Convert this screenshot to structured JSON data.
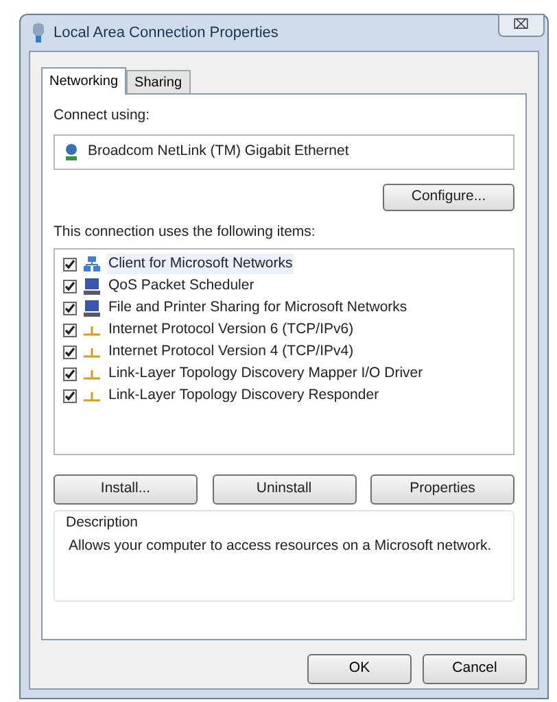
{
  "window": {
    "title": "Local Area Connection Properties",
    "close_label": "⌧"
  },
  "tabs": [
    {
      "label": "Networking",
      "selected": true
    },
    {
      "label": "Sharing",
      "selected": false
    }
  ],
  "connect_using": {
    "label": "Connect using:",
    "adapter": "Broadcom NetLink (TM) Gigabit Ethernet",
    "configure_button": "Configure..."
  },
  "items_label": "This connection uses the following items:",
  "items": [
    {
      "kind": "client",
      "label": "Client for Microsoft Networks",
      "checked": true,
      "selected": true
    },
    {
      "kind": "service",
      "label": "QoS Packet Scheduler",
      "checked": true,
      "selected": false
    },
    {
      "kind": "service",
      "label": "File and Printer Sharing for Microsoft Networks",
      "checked": true,
      "selected": false
    },
    {
      "kind": "protocol",
      "label": "Internet Protocol Version 6 (TCP/IPv6)",
      "checked": true,
      "selected": false
    },
    {
      "kind": "protocol",
      "label": "Internet Protocol Version 4 (TCP/IPv4)",
      "checked": true,
      "selected": false
    },
    {
      "kind": "protocol",
      "label": "Link-Layer Topology Discovery Mapper I/O Driver",
      "checked": true,
      "selected": false
    },
    {
      "kind": "protocol",
      "label": "Link-Layer Topology Discovery Responder",
      "checked": true,
      "selected": false
    }
  ],
  "item_buttons": [
    "Install...",
    "Uninstall",
    "Properties"
  ],
  "description": {
    "label": "Description",
    "text": "Allows your computer to access resources on a Microsoft network."
  },
  "dialog_buttons": [
    "OK",
    "Cancel"
  ]
}
